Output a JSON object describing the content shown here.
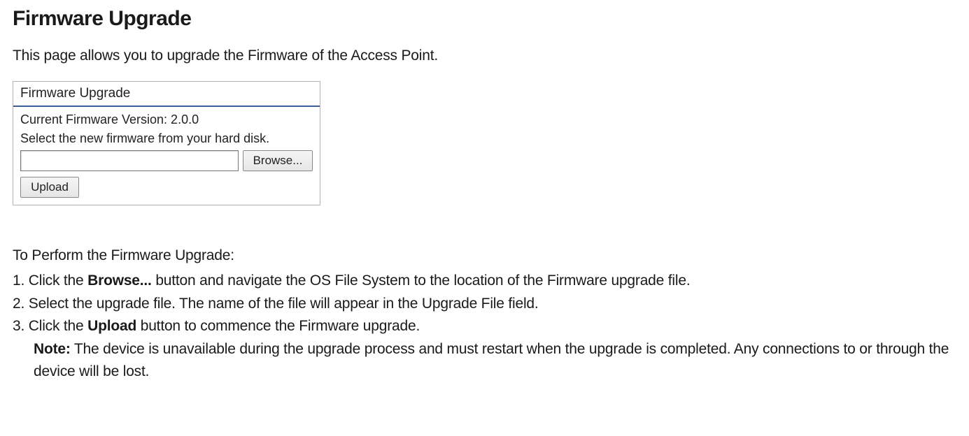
{
  "title": "Firmware Upgrade",
  "intro": "This page allows you to upgrade the Firmware of the Access Point.",
  "panel": {
    "header": "Firmware Upgrade",
    "version_line": "Current Firmware Version: 2.0.0",
    "instruction": "Select the new firmware from your hard disk.",
    "file_value": "",
    "browse_label": "Browse...",
    "upload_label": "Upload"
  },
  "section_title": "To Perform the Firmware Upgrade:",
  "steps": {
    "s1_pre": "Click the ",
    "s1_bold": "Browse...",
    "s1_post": " button and navigate the OS File System to the location of the Firmware upgrade file.",
    "s2": "Select the upgrade file. The name of the file will appear in the Upgrade File field.",
    "s3_pre": "Click the ",
    "s3_bold": "Upload",
    "s3_post": " button to commence the Firmware upgrade."
  },
  "note": {
    "label": "Note:",
    "text": " The device is unavailable during the upgrade process and must restart when the upgrade is completed. Any connections to or through the device will be lost."
  }
}
